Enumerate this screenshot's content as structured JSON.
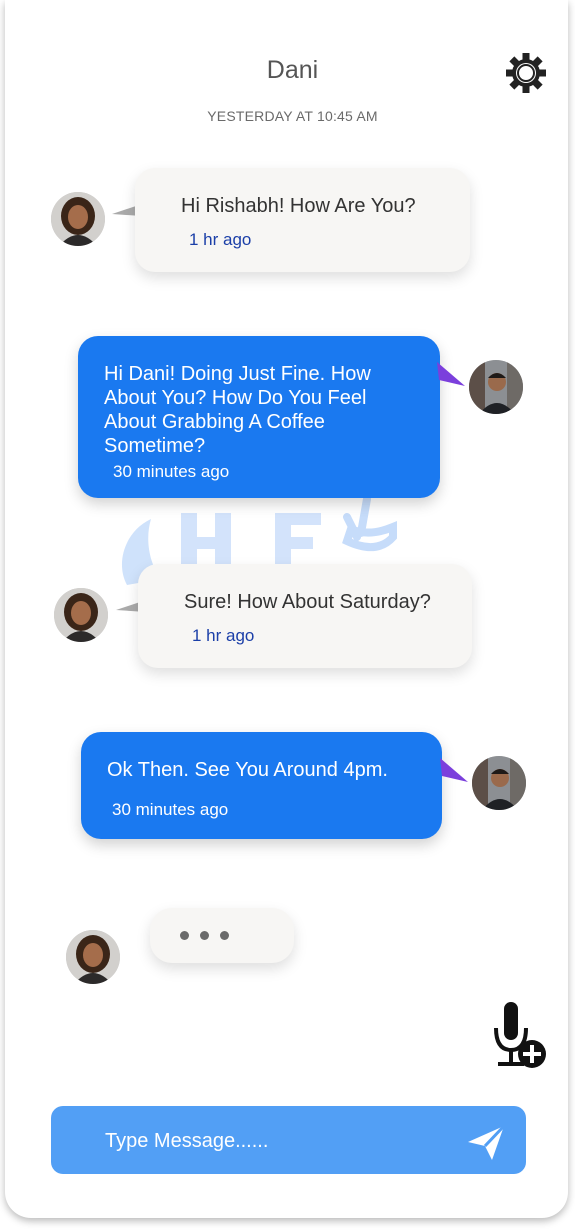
{
  "header": {
    "contact_name": "Dani",
    "timestamp": "YESTERDAY AT 10:45 AM",
    "settings_icon": "gear-icon"
  },
  "messages": [
    {
      "from": "Dani",
      "direction": "incoming",
      "text": "Hi Rishabh! How Are You?",
      "time": "1 hr ago"
    },
    {
      "from": "Rishabh",
      "direction": "outgoing",
      "lines": [
        "Hi Dani! Doing Just Fine. How",
        "About You? How Do You Feel",
        "About Grabbing A Coffee",
        "Sometime?"
      ],
      "time": "30 minutes ago"
    },
    {
      "from": "Dani",
      "direction": "incoming",
      "text": "Sure! How About Saturday?",
      "time": "1 hr ago"
    },
    {
      "from": "Rishabh",
      "direction": "outgoing",
      "text": "Ok Then. See You Around 4pm.",
      "time": "30 minutes ago"
    }
  ],
  "typing_indicator": {
    "from": "Dani",
    "state": "typing"
  },
  "voice_button": {
    "icon": "microphone-add-icon"
  },
  "composer": {
    "placeholder": "Type Message......",
    "value": "",
    "send_icon": "send-icon"
  },
  "colors": {
    "outgoing_bubble": "#1a79f0",
    "incoming_bubble": "#f7f6f4",
    "composer": "#529ff5",
    "time_incoming": "#1b3fa8"
  }
}
